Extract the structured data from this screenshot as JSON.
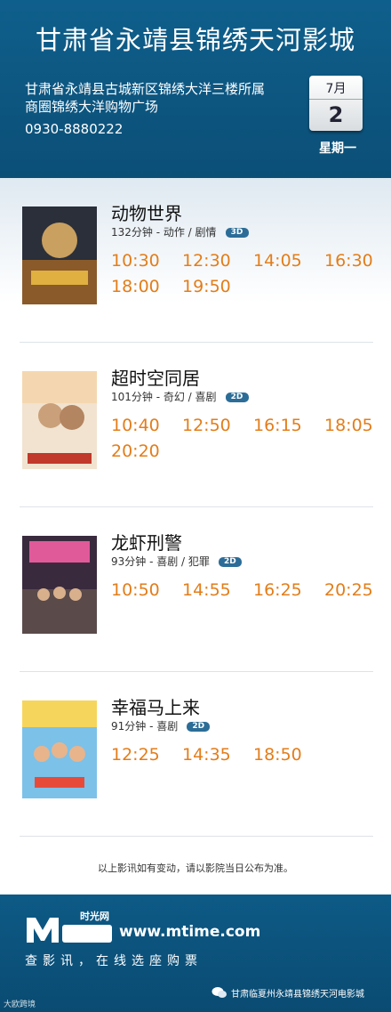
{
  "header": {
    "cinema_name": "甘肃省永靖县锦绣天河影城",
    "address_line1": "甘肃省永靖县古城新区锦绣大洋三楼所属",
    "address_line2": "商圈锦绣大洋购物广场",
    "phone": "0930-8880222",
    "date": {
      "month": "7月",
      "day": "2",
      "weekday": "星期一"
    }
  },
  "movies": [
    {
      "title": "动物世界",
      "meta": "132分钟 - 动作 / 剧情",
      "format": "3D",
      "times": [
        "10:30",
        "12:30",
        "14:05",
        "16:30",
        "18:00",
        "19:50"
      ]
    },
    {
      "title": "超时空同居",
      "meta": "101分钟 - 奇幻 / 喜剧",
      "format": "2D",
      "times": [
        "10:40",
        "12:50",
        "16:15",
        "18:05",
        "20:20"
      ]
    },
    {
      "title": "龙虾刑警",
      "meta": "93分钟 - 喜剧 / 犯罪",
      "format": "2D",
      "times": [
        "10:50",
        "14:55",
        "16:25",
        "20:25"
      ]
    },
    {
      "title": "幸福马上来",
      "meta": "91分钟 - 喜剧",
      "format": "2D",
      "times": [
        "12:25",
        "14:35",
        "18:50"
      ]
    }
  ],
  "notice": "以上影讯如有变动，请以影院当日公布为准。",
  "footer": {
    "logo_cn": "时光网",
    "site": "www.mtime.com",
    "slogan": "查影讯，在线选座购票",
    "wechat_account": "甘肃临夏州永靖县锦绣天河电影城",
    "watermark": "大欧跨境"
  },
  "colors": {
    "header_bg": "#0f5f8c",
    "time_color": "#e37d1a",
    "badge_bg": "#2c6d98"
  }
}
